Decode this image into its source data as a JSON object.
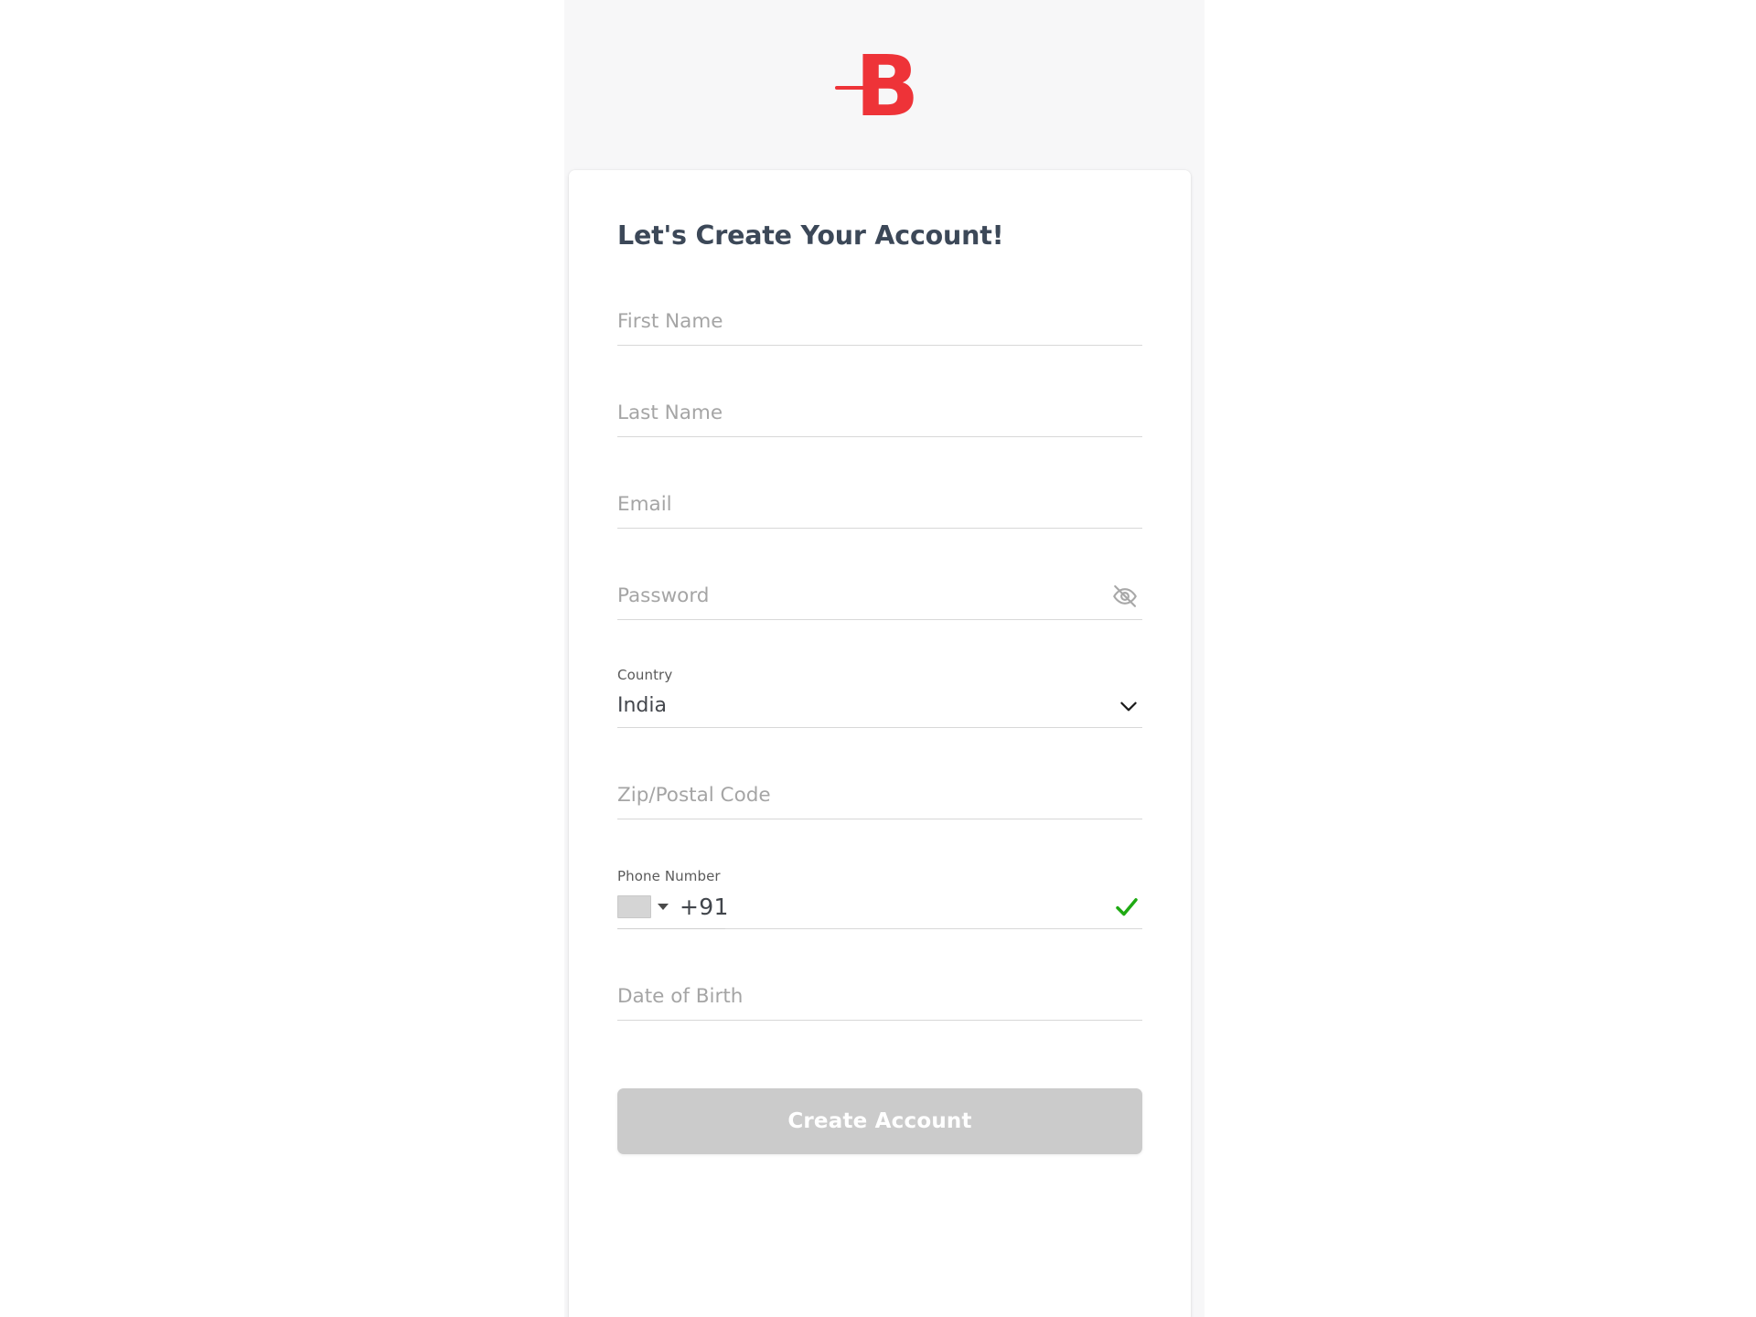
{
  "brand": {
    "logo_text": "B",
    "logo_icon": "brand-b-logo",
    "accent_color": "#ee3338"
  },
  "card": {
    "title": "Let's Create Your Account!"
  },
  "fields": {
    "first_name": {
      "placeholder": "First Name",
      "value": ""
    },
    "last_name": {
      "placeholder": "Last Name",
      "value": ""
    },
    "email": {
      "placeholder": "Email",
      "value": ""
    },
    "password": {
      "placeholder": "Password",
      "value": "",
      "toggle_icon": "eye-off-icon"
    },
    "country": {
      "label": "Country",
      "value": "India",
      "chevron_icon": "chevron-down-icon"
    },
    "zip": {
      "placeholder": "Zip/Postal Code",
      "value": ""
    },
    "phone": {
      "label": "Phone Number",
      "dial_code": "+91",
      "flag_icon": "country-flag-placeholder",
      "caret_icon": "caret-down-icon",
      "status_icon": "check-valid-icon",
      "status_color": "#1faa13"
    },
    "date_of_birth": {
      "placeholder": "Date of Birth",
      "value": ""
    }
  },
  "actions": {
    "submit_label": "Create Account",
    "submit_disabled_color": "#cbcbcb"
  }
}
